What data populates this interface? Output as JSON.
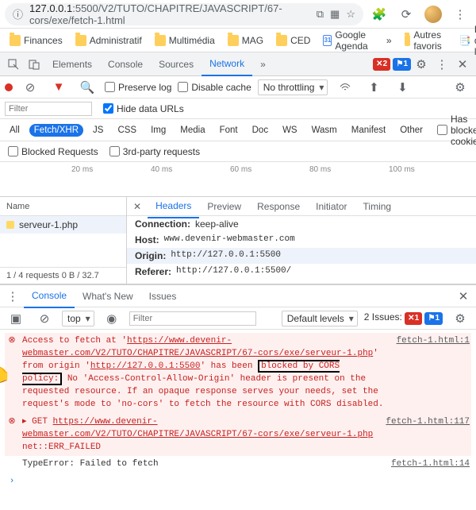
{
  "addr": {
    "url_prefix": "127.0.0.1",
    "url_suffix": ":5500/V2/TUTO/CHAPITRE/JAVASCRIPT/67-cors/exe/fetch-1.html"
  },
  "bookmarks": [
    "Finances",
    "Administratif",
    "Multimédia",
    "MAG",
    "CED",
    "Google Agenda",
    "Autres favoris",
    "Liste de lecture"
  ],
  "devtabs": {
    "items": [
      "Elements",
      "Console",
      "Sources",
      "Network"
    ],
    "active": "Network",
    "err": 2,
    "warn": 1
  },
  "toolbar": {
    "preserve": "Preserve log",
    "disable": "Disable cache",
    "throttle": "No throttling"
  },
  "filter": {
    "placeholder": "Filter",
    "hide": "Hide data URLs"
  },
  "types": {
    "items": [
      "All",
      "Fetch/XHR",
      "JS",
      "CSS",
      "Img",
      "Media",
      "Font",
      "Doc",
      "WS",
      "Wasm",
      "Manifest",
      "Other"
    ],
    "active": "Fetch/XHR",
    "blocked": "Has blocked cookies"
  },
  "extra": {
    "blockedreq": "Blocked Requests",
    "third": "3rd-party requests"
  },
  "timeline": [
    "20 ms",
    "40 ms",
    "60 ms",
    "80 ms",
    "100 ms"
  ],
  "reqlist": {
    "header": "Name",
    "item": "serveur-1.php",
    "footer": "1 / 4 requests    0 B / 32.7"
  },
  "detail": {
    "tabs": [
      "Headers",
      "Preview",
      "Response",
      "Initiator",
      "Timing"
    ],
    "active": "Headers",
    "rows": [
      {
        "k": "Connection:",
        "v": "keep-alive"
      },
      {
        "k": "Host:",
        "v": "www.devenir-webmaster.com"
      },
      {
        "k": "Origin:",
        "v": "http://127.0.0.1:5500"
      },
      {
        "k": "Referer:",
        "v": "http://127.0.0.1:5500/"
      }
    ]
  },
  "drawer": {
    "tabs": [
      "Console",
      "What's New",
      "Issues"
    ],
    "active": "Console",
    "top": "top",
    "filter": "Filter",
    "levels": "Default levels",
    "issues": "2 Issues:",
    "i_err": 1,
    "i_warn": 1
  },
  "console": {
    "m1_a": "Access to fetch at '",
    "m1_b": "https://www.devenir-webmaster.com/V2/TUTO/CHAPITRE/JAVASCRIPT/67-cors/exe/serveur-1.php",
    "m1_c": "' from origin '",
    "m1_d": "http://127.0.0.1:5500",
    "m1_e": "' has been ",
    "m1_box": "blocked by CORS policy:",
    "m1_f": " No 'Access-Control-Allow-Origin' header is present on the requested resource. If an opaque response serves your needs, set the request's mode to 'no-cors' to fetch the resource with CORS disabled.",
    "m1_src": "fetch-1.html:1",
    "m2_a": "GET ",
    "m2_b": "https://www.devenir-webmaster.com/V2/TUTO/CHAPITRE/JAVASCRIPT/67-cors/exe/serveur-1.php",
    "m2_c": " net::ERR_FAILED",
    "m2_src": "fetch-1.html:117",
    "m3": "TypeError: Failed to fetch",
    "m3_src": "fetch-1.html:14"
  }
}
